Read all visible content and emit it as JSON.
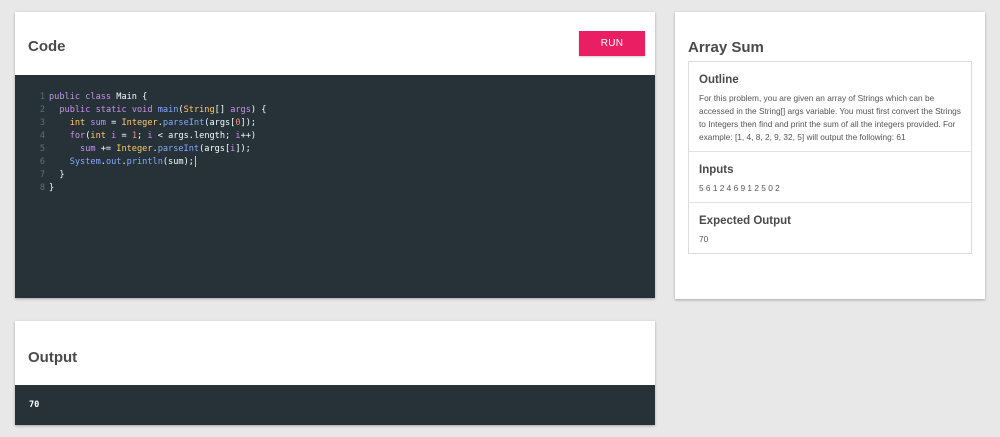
{
  "code_panel": {
    "title": "Code",
    "run_label": "RUN",
    "lines": [
      {
        "num": "1",
        "tokens": [
          [
            "k",
            "public"
          ],
          [
            "pl",
            " "
          ],
          [
            "k",
            "class"
          ],
          [
            "pl",
            " Main {"
          ]
        ]
      },
      {
        "num": "2",
        "tokens": [
          [
            "pl",
            "  "
          ],
          [
            "k",
            "public"
          ],
          [
            "pl",
            " "
          ],
          [
            "k",
            "static"
          ],
          [
            "pl",
            " "
          ],
          [
            "k",
            "void"
          ],
          [
            "pl",
            " "
          ],
          [
            "f",
            "main"
          ],
          [
            "pl",
            "("
          ],
          [
            "t",
            "String"
          ],
          [
            "pl",
            "[] "
          ],
          [
            "k",
            "args"
          ],
          [
            "pl",
            ") {"
          ]
        ]
      },
      {
        "num": "3",
        "tokens": [
          [
            "pl",
            "    "
          ],
          [
            "t",
            "int"
          ],
          [
            "pl",
            " "
          ],
          [
            "k",
            "sum"
          ],
          [
            "pl",
            " = "
          ],
          [
            "t",
            "Integer"
          ],
          [
            "pl",
            "."
          ],
          [
            "f",
            "parseInt"
          ],
          [
            "pl",
            "(args["
          ],
          [
            "n",
            "0"
          ],
          [
            "pl",
            "]);"
          ]
        ]
      },
      {
        "num": "4",
        "tokens": [
          [
            "pl",
            "    "
          ],
          [
            "k",
            "for"
          ],
          [
            "pl",
            "("
          ],
          [
            "t",
            "int"
          ],
          [
            "pl",
            " "
          ],
          [
            "k",
            "i"
          ],
          [
            "pl",
            " = "
          ],
          [
            "n",
            "1"
          ],
          [
            "pl",
            "; "
          ],
          [
            "k",
            "i"
          ],
          [
            "pl",
            " < args.length; "
          ],
          [
            "k",
            "i"
          ],
          [
            "pl",
            "++)"
          ]
        ]
      },
      {
        "num": "5",
        "tokens": [
          [
            "pl",
            "      "
          ],
          [
            "k",
            "sum"
          ],
          [
            "pl",
            " += "
          ],
          [
            "t",
            "Integer"
          ],
          [
            "pl",
            "."
          ],
          [
            "f",
            "parseInt"
          ],
          [
            "pl",
            "(args["
          ],
          [
            "k",
            "i"
          ],
          [
            "pl",
            "]);"
          ]
        ]
      },
      {
        "num": "6",
        "tokens": [
          [
            "pl",
            "    "
          ],
          [
            "f",
            "System"
          ],
          [
            "pl",
            "."
          ],
          [
            "f",
            "out"
          ],
          [
            "pl",
            "."
          ],
          [
            "f",
            "println"
          ],
          [
            "pl",
            "(sum);"
          ]
        ],
        "cursor": true
      },
      {
        "num": "7",
        "tokens": [
          [
            "pl",
            "  }"
          ]
        ]
      },
      {
        "num": "8",
        "tokens": [
          [
            "pl",
            "}"
          ]
        ]
      }
    ]
  },
  "output_panel": {
    "title": "Output",
    "value": "70"
  },
  "problem_panel": {
    "title": "Array Sum",
    "outline_heading": "Outline",
    "outline_text": "For this problem, you are given an array of Strings which can be accessed in the String[] args variable. You must first convert the Strings to Integers then find and print the sum of all the integers provided. For example: [1, 4, 8, 2, 9, 32, 5] will output the following: 61",
    "inputs_heading": "Inputs",
    "inputs_text": "5 6 1 2 4 6 9 1 2 5 0 2",
    "expected_heading": "Expected Output",
    "expected_text": "70"
  },
  "colors": {
    "accent": "#e91e63",
    "editor_bg": "#263238",
    "page_bg": "#e8e8e8"
  }
}
